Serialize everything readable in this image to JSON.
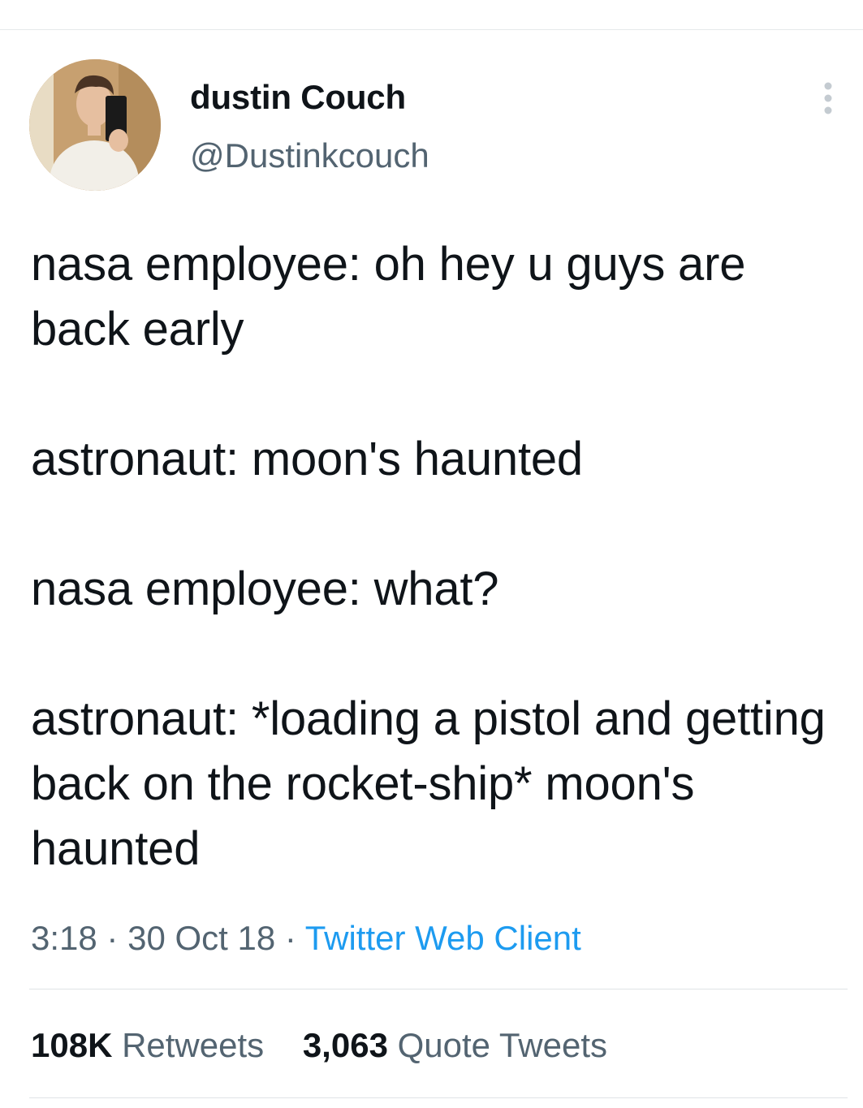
{
  "author": {
    "name": "dustin Couch",
    "handle": "@Dustinkcouch"
  },
  "tweet": {
    "text": "nasa employee: oh hey u guys are back early\n\nastronaut: moon's haunted\n\nnasa employee: what?\n\nastronaut: *loading a pistol and getting back on the rocket-ship* moon's haunted"
  },
  "meta": {
    "time": "3:18",
    "separator": "·",
    "date": "30 Oct 18",
    "source": "Twitter Web Client"
  },
  "stats": {
    "retweets_count": "108K",
    "retweets_label": "Retweets",
    "quotes_count": "3,063",
    "quotes_label": "Quote Tweets"
  },
  "icons": {
    "more": "more-vertical-icon",
    "avatar": "avatar-photo"
  },
  "colors": {
    "link": "#1d9bf0",
    "secondary_text": "#536471",
    "primary_text": "#0f1419"
  }
}
